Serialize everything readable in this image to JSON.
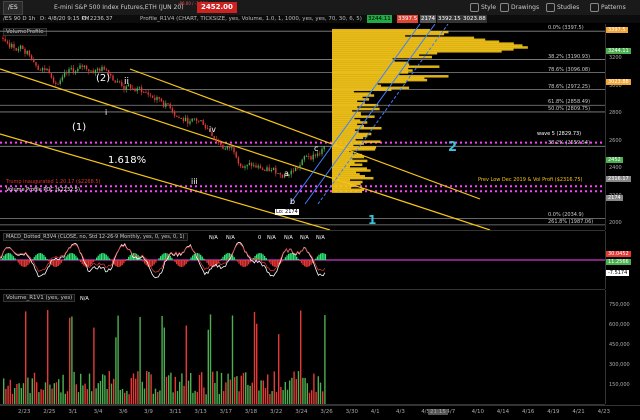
{
  "toolbar": {
    "symbol": "/ES",
    "title": "E-mini S&P 500 Index Futures,ETH (JUN 20)",
    "change": "-86.00 / -3.51%",
    "last_price": "2452.00",
    "style_label": "Style",
    "drawings_label": "Drawings",
    "studies_label": "Studies",
    "patterns_label": "Patterns"
  },
  "study_row": {
    "chart_name": "/ES 90 D 1h",
    "date": "D: 4/8/20 9:15 PM",
    "o": "O: 2236.37",
    "h": "H: 2451.75",
    "l": "L: 2230.50",
    "c": "C: 2452.00",
    "profile": "Profile_R1V4 (CHART, TICKSIZE, yes, Volume, 1.0, 1, 1000, yes, yes, 70, 30, 6, 5)",
    "val1": "3244.11",
    "val2": "3397.5",
    "val3": "2174",
    "val4": "3392.15",
    "val5": "3023.88"
  },
  "price_pane": {
    "volume_profile_label": "VolumeProfile",
    "wave_labels": [
      "(2)",
      "ii",
      "(1)",
      "i",
      "iv",
      "iii",
      "a",
      "b",
      "c",
      "2",
      "1"
    ],
    "fib_label": "1.618%",
    "notes": {
      "trump": "Trump inaugurated 1.20.17 ($2268.5)",
      "volume_profile_poc": "Volume Profile POC ($2232.5)",
      "prev_low": "Prev Low Dec 2019 & Vol Profi ($2316.75)",
      "lo_label": "Lo: 2174",
      "wave5": "wave 5 (2829.73)"
    },
    "fib_levels": [
      {
        "label": "0.0% (3397.5)",
        "price": 3397.5
      },
      {
        "label": "38.2% (3190.93)",
        "price": 3190.93
      },
      {
        "label": "78.6% (3096.08)",
        "price": 3096.08
      },
      {
        "label": "78.6% (2972.25)",
        "price": 2972.25
      },
      {
        "label": "61.8% (2858.49)",
        "price": 2858.49
      },
      {
        "label": "50.0% (2809.75)",
        "price": 2809.75
      },
      {
        "label": "38.2% (2559.54)",
        "price": 2559.54
      },
      {
        "label": "0.0% (2034.9)",
        "price": 2034.9
      },
      {
        "label": "261.8% (1987.06)",
        "price": 1987.06
      }
    ],
    "axis_ticks": [
      "3400",
      "3200",
      "3000",
      "2800",
      "2600",
      "2400",
      "2200",
      "2000"
    ],
    "price_tags": [
      {
        "text": "3397.5",
        "color": "#f2a53a"
      },
      {
        "text": "3244.11",
        "color": "#4caf50"
      },
      {
        "text": "3023.88",
        "color": "#f2a53a"
      },
      {
        "text": "2452",
        "color": "#4caf50"
      },
      {
        "text": "2316.17",
        "color": "#888888"
      },
      {
        "text": "2174",
        "color": "#888888"
      }
    ]
  },
  "macd_pane": {
    "title": "MACD_Dotted_R3V4 (CLOSE, no, Std 12-26-9 Monthly, yes, 0, yes, 0, 1)",
    "na": [
      "N/A",
      "N/A",
      "0",
      "N/A",
      "N/A",
      "N/A",
      "N/A"
    ],
    "tags": [
      {
        "text": "30.0452",
        "color": "#e53935"
      },
      {
        "text": "11.2566",
        "color": "#4caf50"
      },
      {
        "text": "-7.5174",
        "color": "#000000"
      }
    ]
  },
  "volume_pane": {
    "title": "Volume_R1V1 (yes, yes)",
    "na": "N/A",
    "axis_ticks": [
      "750,000",
      "600,000",
      "450,000",
      "300,000",
      "150,000"
    ]
  },
  "x_axis": {
    "labels": [
      "2/23",
      "2/25",
      "3/1",
      "3/4",
      "3/6",
      "3/9",
      "3/11",
      "3/13",
      "3/17",
      "3/18",
      "3/22",
      "3/24",
      "3/26",
      "3/30",
      "4/1",
      "4/3",
      "4/5",
      "4/7",
      "4/10",
      "4/14",
      "4/16",
      "4/19",
      "4/21",
      "4/23"
    ],
    "time_tag": "21:15"
  },
  "colors": {
    "background": "#000000",
    "up_candle": "#4caf50",
    "down_candle": "#e53935",
    "channel": "#f5c518",
    "blue_channel": "#3f7fff",
    "profile": "#f5c518",
    "magenta": "#ff3fff"
  }
}
